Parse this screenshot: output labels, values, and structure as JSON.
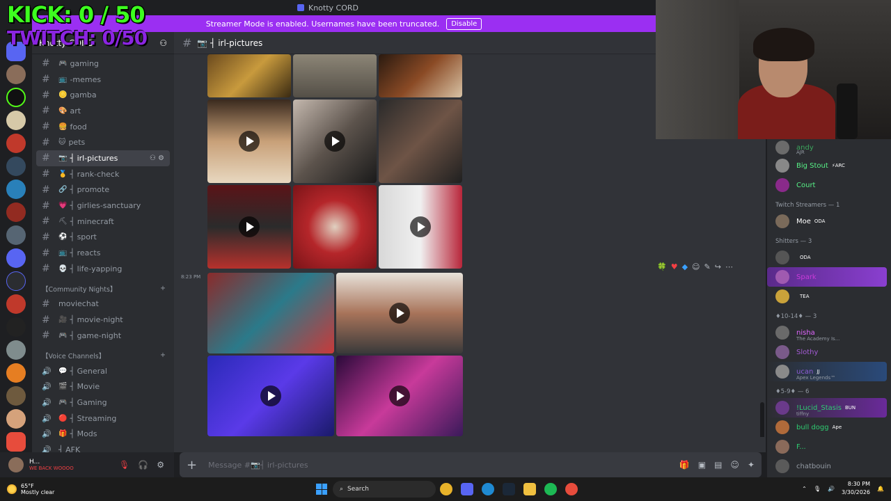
{
  "window": {
    "title": "Knotty CORD"
  },
  "banner": {
    "text": "Streamer Mode is enabled. Usernames have been truncated.",
    "button": "Disable"
  },
  "overlay": {
    "kick": "KICK: 0 / 50",
    "twitch": "TWITCH: 0/50"
  },
  "server": {
    "name": "Knotty CORD"
  },
  "channels": [
    {
      "emoji": "🎮",
      "label": "gaming"
    },
    {
      "emoji": "📺",
      "label": "-memes"
    },
    {
      "emoji": "🪙",
      "label": "gamba"
    },
    {
      "emoji": "🎨",
      "label": "art"
    },
    {
      "emoji": "🍔",
      "label": "food"
    },
    {
      "emoji": "🐱",
      "label": "pets"
    },
    {
      "emoji": "📷",
      "label": "┤ irl-pictures"
    },
    {
      "emoji": "🥇",
      "label": "┤ rank-check"
    },
    {
      "emoji": "🔗",
      "label": "┤ promote"
    },
    {
      "emoji": "💗",
      "label": "┤ girlies-sanctuary"
    },
    {
      "emoji": "⛏",
      "label": "┤ minecraft"
    },
    {
      "emoji": "⚽",
      "label": "┤ sport"
    },
    {
      "emoji": "📺",
      "label": "┤ reacts"
    },
    {
      "emoji": "💀",
      "label": "┤ life-yapping"
    }
  ],
  "community": {
    "category": "【Community Nights】",
    "channels": [
      {
        "emoji": "",
        "label": "moviechat"
      },
      {
        "emoji": "🎥",
        "label": "┤ movie-night"
      },
      {
        "emoji": "🎮",
        "label": "┤ game-night"
      }
    ]
  },
  "voice": {
    "category": "【Voice Channels】",
    "channels": [
      {
        "emoji": "💬",
        "label": "┤ General"
      },
      {
        "emoji": "🎬",
        "label": "┤ Movie"
      },
      {
        "emoji": "🎮",
        "label": "┤ Gaming"
      },
      {
        "emoji": "🔴",
        "label": "┤ Streaming"
      },
      {
        "emoji": "🎁",
        "label": "┤ Mods"
      },
      {
        "emoji": "",
        "label": "┤ AFK"
      }
    ]
  },
  "user": {
    "name": "H...",
    "status": "WE BACK WOOOO"
  },
  "main": {
    "channel": "📷 ┤ irl-pictures",
    "timestamp": "8:23 PM",
    "composer_placeholder": "Message #📷┤ irl-pictures"
  },
  "members": {
    "top": [
      {
        "name": "andy",
        "sub": "AJR",
        "color": "#3ba55c"
      },
      {
        "name": "Big Stout",
        "tag": "⚡ARC",
        "color": "#57f287"
      },
      {
        "name": "Court",
        "color": "#57f287"
      }
    ],
    "groups": [
      {
        "title": "Twitch Streamers — 1",
        "rows": [
          {
            "name": "Moe",
            "tag": "ODA",
            "color": "#fff"
          }
        ]
      },
      {
        "title": "Shitters — 3",
        "rows": [
          {
            "name": "",
            "tag": "ODA",
            "color": "#949ba4"
          },
          {
            "name": "Spark",
            "color": "#c93bd8"
          },
          {
            "name": "",
            "tag": "TEA",
            "color": "#949ba4"
          }
        ]
      },
      {
        "title": "♦10-14♦ — 3",
        "rows": [
          {
            "name": "nisha",
            "sub": "The Academy Is...",
            "color": "#e066ff"
          },
          {
            "name": "Slothy",
            "color": "#a55bd6"
          },
          {
            "name": "ucan",
            "tag": "JJ",
            "sub": "Apex Legends™",
            "color": "#8e5cd6"
          }
        ]
      },
      {
        "title": "♦5-9♦ — 6",
        "rows": [
          {
            "name": "!Lucid_Stasis",
            "tag": "BUN",
            "sub": "tiffny",
            "color": "#2ecc71"
          },
          {
            "name": "bull dogg",
            "tag": "Ape",
            "color": "#2ecc71"
          },
          {
            "name": "F...",
            "color": "#2ecc71"
          },
          {
            "name": "chatbouin",
            "color": "#949ba4"
          }
        ]
      }
    ]
  },
  "taskbar": {
    "weather_temp": "65°F",
    "weather_desc": "Mostly clear",
    "search": "Search",
    "time": "8:30 PM",
    "date": "3/30/2026"
  },
  "colors": {
    "accent": "#5865f2",
    "banner": "#9b2ff2",
    "overlay_green": "#3dff1f"
  }
}
